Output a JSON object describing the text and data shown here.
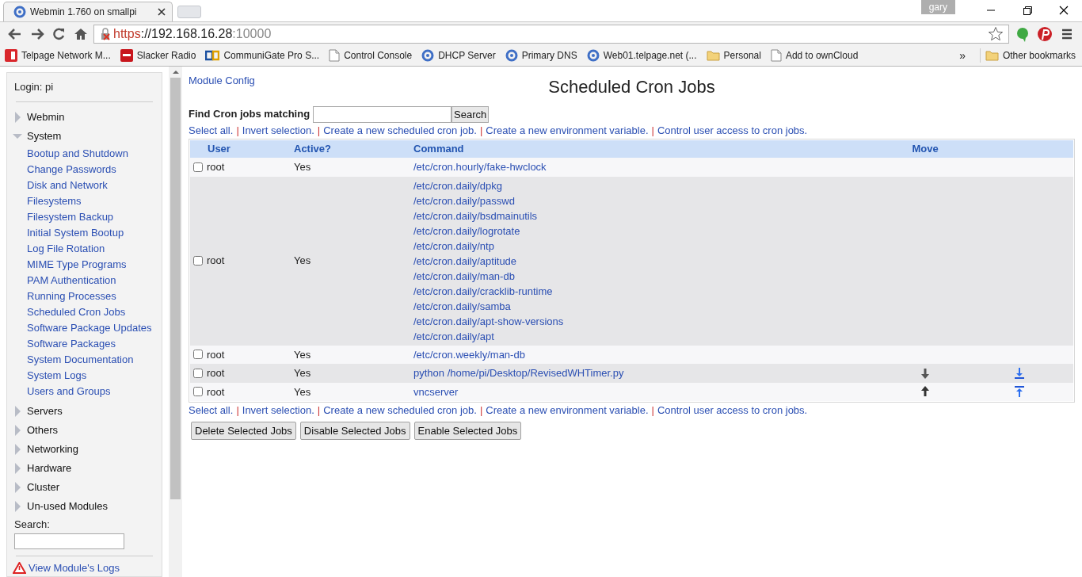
{
  "browser": {
    "tab": {
      "title": "Webmin 1.760 on smallpi",
      "selected": true
    },
    "profile": "gary",
    "address": {
      "scheme": "https",
      "host": "://192.168.16.28",
      "port": ":10000"
    },
    "bookmarks": [
      {
        "kind": "red",
        "label": "Telpage Network M..."
      },
      {
        "kind": "slacker",
        "label": "Slacker Radio"
      },
      {
        "kind": "cg",
        "label": "CommuniGate Pro S..."
      },
      {
        "kind": "page",
        "label": "Control Console"
      },
      {
        "kind": "webmin",
        "label": "DHCP Server"
      },
      {
        "kind": "webmin",
        "label": "Primary DNS"
      },
      {
        "kind": "webmin",
        "label": "Web01.telpage.net (..."
      },
      {
        "kind": "folder",
        "label": "Personal"
      },
      {
        "kind": "page",
        "label": "Add to ownCloud"
      }
    ],
    "overflow": "»",
    "other": {
      "kind": "folder",
      "label": "Other bookmarks"
    }
  },
  "sidebar": {
    "login": "Login: pi",
    "categories": [
      {
        "label": "Webmin",
        "expanded": false
      },
      {
        "label": "System",
        "expanded": true,
        "children": [
          "Bootup and Shutdown",
          "Change Passwords",
          "Disk and Network",
          "Filesystems",
          "Filesystem Backup",
          "Initial System Bootup",
          "Log File Rotation",
          "MIME Type Programs",
          "PAM Authentication",
          "Running Processes",
          "Scheduled Cron Jobs",
          "Software Package Updates",
          "Software Packages",
          "System Documentation",
          "System Logs",
          "Users and Groups"
        ]
      },
      {
        "label": "Servers",
        "expanded": false
      },
      {
        "label": "Others",
        "expanded": false
      },
      {
        "label": "Networking",
        "expanded": false
      },
      {
        "label": "Hardware",
        "expanded": false
      },
      {
        "label": "Cluster",
        "expanded": false
      },
      {
        "label": "Un-used Modules",
        "expanded": false
      }
    ],
    "search_label": "Search:",
    "logs_link": "View Module's Logs"
  },
  "main": {
    "module_config": "Module Config",
    "title": "Scheduled Cron Jobs",
    "find_label": "Find Cron jobs matching",
    "search_button": "Search",
    "separator": "|",
    "links_top": [
      "Select all.",
      "Invert selection.",
      "Create a new scheduled cron job.",
      "Create a new environment variable.",
      "Control user access to cron jobs."
    ],
    "table": {
      "columns": [
        "User",
        "Active?",
        "Command",
        "Move"
      ],
      "rows": [
        {
          "checked": false,
          "user": "root",
          "active": "Yes",
          "commands": [
            "/etc/cron.hourly/fake-hwclock"
          ],
          "can_move_down": false,
          "can_move_up": false
        },
        {
          "checked": false,
          "user": "root",
          "active": "Yes",
          "commands": [
            "/etc/cron.daily/dpkg",
            "/etc/cron.daily/passwd",
            "/etc/cron.daily/bsdmainutils",
            "/etc/cron.daily/logrotate",
            "/etc/cron.daily/ntp",
            "/etc/cron.daily/aptitude",
            "/etc/cron.daily/man-db",
            "/etc/cron.daily/cracklib-runtime",
            "/etc/cron.daily/samba",
            "/etc/cron.daily/apt-show-versions",
            "/etc/cron.daily/apt"
          ],
          "can_move_down": false,
          "can_move_up": false
        },
        {
          "checked": false,
          "user": "root",
          "active": "Yes",
          "commands": [
            "/etc/cron.weekly/man-db"
          ],
          "can_move_down": false,
          "can_move_up": false
        },
        {
          "checked": false,
          "user": "root",
          "active": "Yes",
          "commands": [
            "python /home/pi/Desktop/RevisedWHTimer.py"
          ],
          "can_move_down": true,
          "can_move_up": false
        },
        {
          "checked": false,
          "user": "root",
          "active": "Yes",
          "commands": [
            "vncserver"
          ],
          "can_move_down": false,
          "can_move_up": true
        }
      ]
    },
    "links_bottom": [
      "Select all.",
      "Invert selection.",
      "Create a new scheduled cron job.",
      "Create a new environment variable.",
      "Control user access to cron jobs."
    ],
    "buttons": [
      "Delete Selected Jobs",
      "Disable Selected Jobs",
      "Enable Selected Jobs"
    ]
  }
}
